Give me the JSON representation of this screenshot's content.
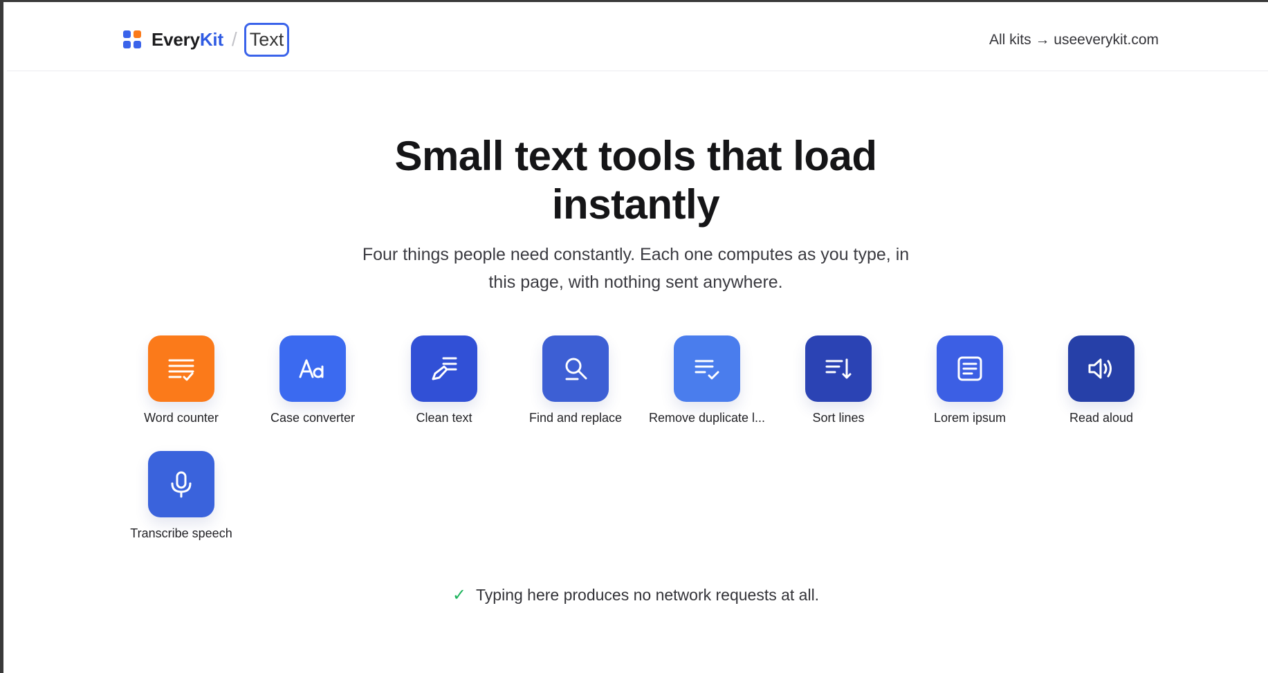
{
  "header": {
    "brand_every": "Every",
    "brand_kit": "Kit",
    "separator": "/",
    "kit_label": "Text",
    "all_kits": "All kits → useeverykit.com",
    "logo_colors": [
      "#3a63ea",
      "#fb7a1a",
      "#3a63ea",
      "#3a63ea"
    ]
  },
  "hero": {
    "title_line1": "Small text tools that load",
    "title_line2": "instantly",
    "subtitle_line1": "Four things people need constantly. Each one computes as you type, in",
    "subtitle_line2": "this page, with nothing sent anywhere."
  },
  "tools": [
    {
      "label": "Word counter",
      "icon": "word-counter-icon",
      "color": "#fb7a1a"
    },
    {
      "label": "Case converter",
      "icon": "case-converter-icon",
      "color": "#3b6af0"
    },
    {
      "label": "Clean text",
      "icon": "clean-text-icon",
      "color": "#3150d6"
    },
    {
      "label": "Find and replace",
      "icon": "search-icon",
      "color": "#3d5fd4"
    },
    {
      "label": "Remove duplicate l...",
      "icon": "list-check-icon",
      "color": "#4a7ded"
    },
    {
      "label": "Sort lines",
      "icon": "sort-lines-icon",
      "color": "#2b43b4"
    },
    {
      "label": "Lorem ipsum",
      "icon": "document-icon",
      "color": "#3c5fe4"
    },
    {
      "label": "Read aloud",
      "icon": "speaker-icon",
      "color": "#2640a8"
    },
    {
      "label": "Transcribe speech",
      "icon": "microphone-icon",
      "color": "#3a63dc"
    }
  ],
  "footer": {
    "check_icon": "check-icon",
    "note": "Typing here produces no network requests at all.",
    "check_color": "#1cb35c"
  }
}
